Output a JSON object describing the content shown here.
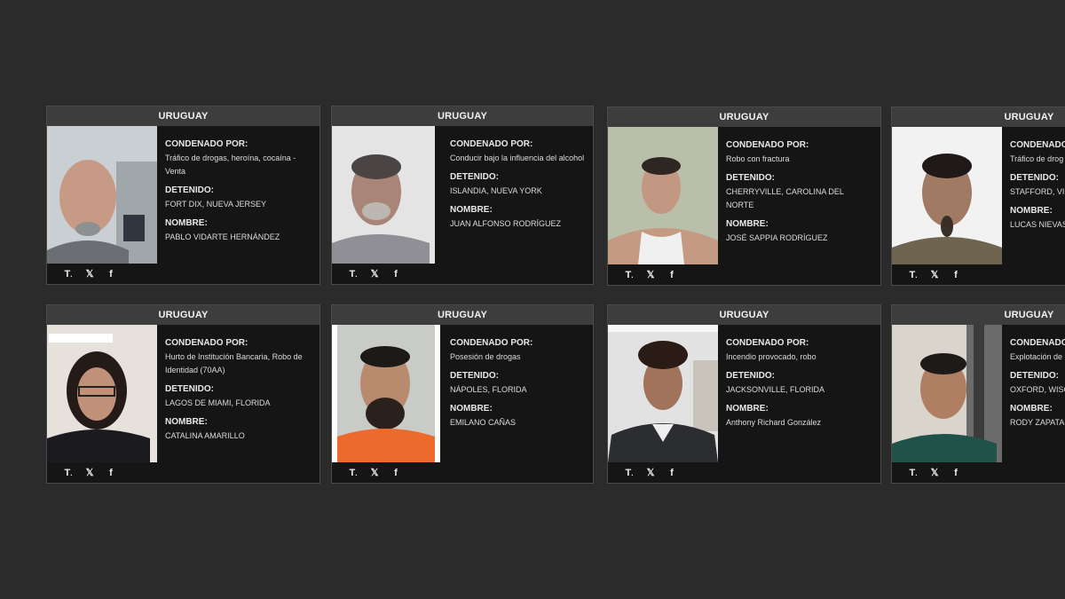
{
  "cards": [
    {
      "country": "URUGUAY",
      "convicted_label": "CONDENADO POR:",
      "convicted_value": "Tráfico de drogas, heroína, cocaína - Venta",
      "detained_label": "DETENIDO:",
      "detained_value": "FORT DIX, NUEVA JERSEY",
      "name_label": "NOMBRE:",
      "name_value": "PABLO VIDARTE HERNÁNDEZ",
      "share_icons": [
        "tn-logo-icon",
        "x-icon",
        "facebook-icon"
      ]
    },
    {
      "country": "URUGUAY",
      "convicted_label": "CONDENADO POR:",
      "convicted_value": "Conducir bajo la influencia del alcohol",
      "detained_label": "DETENIDO:",
      "detained_value": "ISLANDIA, NUEVA YORK",
      "name_label": "NOMBRE:",
      "name_value": "JUAN ALFONSO RODRÍGUEZ",
      "share_icons": [
        "tn-logo-icon",
        "x-icon",
        "facebook-icon"
      ]
    },
    {
      "country": "URUGUAY",
      "convicted_label": "CONDENADO POR:",
      "convicted_value": "Robo con fractura",
      "detained_label": "DETENIDO:",
      "detained_value": "CHERRYVILLE, CAROLINA DEL NORTE",
      "name_label": "NOMBRE:",
      "name_value": "JOSÉ SAPPIA RODRÍGUEZ",
      "share_icons": [
        "tn-logo-icon",
        "x-icon",
        "facebook-icon"
      ]
    },
    {
      "country": "URUGUAY",
      "convicted_label": "CONDENADO POR:",
      "convicted_value": "Tráfico de drog",
      "detained_label": "DETENIDO:",
      "detained_value": "STAFFORD, VIR",
      "name_label": "NOMBRE:",
      "name_value": "LUCAS NIEVAS",
      "share_icons": [
        "tn-logo-icon",
        "x-icon",
        "facebook-icon"
      ]
    },
    {
      "country": "URUGUAY",
      "convicted_label": "CONDENADO POR:",
      "convicted_value": "Hurto de Institución Bancaria, Robo de Identidad (70AA)",
      "detained_label": "DETENIDO:",
      "detained_value": "LAGOS DE MIAMI, FLORIDA",
      "name_label": "NOMBRE:",
      "name_value": "CATALINA AMARILLO",
      "share_icons": [
        "tn-logo-icon",
        "x-icon",
        "facebook-icon"
      ]
    },
    {
      "country": "URUGUAY",
      "convicted_label": "CONDENADO POR:",
      "convicted_value": "Posesión de drogas",
      "detained_label": "DETENIDO:",
      "detained_value": "NÁPOLES, FLORIDA",
      "name_label": "NOMBRE:",
      "name_value": "EMILANO CAÑAS",
      "share_icons": [
        "tn-logo-icon",
        "x-icon",
        "facebook-icon"
      ]
    },
    {
      "country": "URUGUAY",
      "convicted_label": "CONDENADO POR:",
      "convicted_value": "Incendio provocado, robo",
      "detained_label": "DETENIDO:",
      "detained_value": "JACKSONVILLE, FLORIDA",
      "name_label": "NOMBRE:",
      "name_value": "Anthony Richard González",
      "share_icons": [
        "tn-logo-icon",
        "x-icon",
        "facebook-icon"
      ]
    },
    {
      "country": "URUGUAY",
      "convicted_label": "CONDENADO",
      "convicted_value": "Explotación de",
      "detained_label": "DETENIDO:",
      "detained_value": "OXFORD, WISC",
      "name_label": "NOMBRE:",
      "name_value": "RODY ZAPATA-",
      "share_icons": [
        "tn-logo-icon",
        "x-icon",
        "facebook-icon"
      ]
    }
  ],
  "colors": {
    "page_background": "#2b2b2b",
    "card_background": "#151515",
    "header_background": "#3d3d3d",
    "text": "#e8e8e8"
  }
}
